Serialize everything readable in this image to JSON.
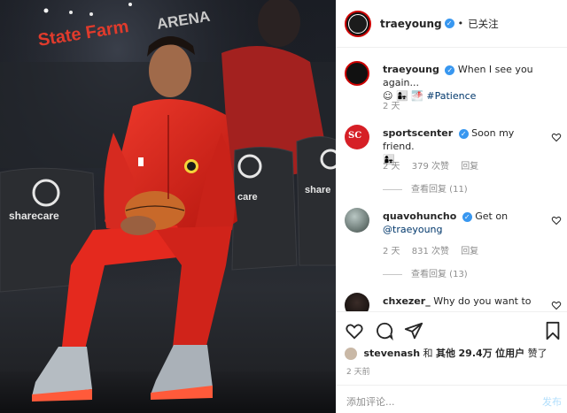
{
  "header": {
    "username": "traeyoung",
    "follow_status": "已关注"
  },
  "caption": {
    "username": "traeyoung",
    "text": "When I see you again...",
    "emojis": "☺ 👩‍👧 🌁",
    "hashtag": "#Patience",
    "age": "2 天"
  },
  "comments": [
    {
      "username": "sportscenter",
      "text": "Soon my friend.",
      "second_line": "👩‍👧",
      "age": "2 天",
      "likes": "379 次赞",
      "reply": "回复",
      "view_replies": "查看回复 (11)",
      "avatar_text": "SC"
    },
    {
      "username": "quavohuncho",
      "text": "Get on",
      "second_line": "@traeyoung",
      "age": "2 天",
      "likes": "831 次赞",
      "reply": "回复",
      "view_replies": "查看回复 (13)"
    },
    {
      "username": "chxezer_",
      "text": "Why do you want to"
    }
  ],
  "likes": {
    "liker": "stevenash",
    "connector": "和",
    "others": "其他",
    "count": "29.4万",
    "suffix": "位用户",
    "action": "赞了"
  },
  "post_time": "2 天前",
  "comment_box": {
    "placeholder": "添加评论...",
    "post_label": "发布"
  },
  "photo": {
    "arena_sign": "State Farm",
    "arena_sign_2": "ARENA",
    "seat_brand": "sharecare"
  },
  "colors": {
    "verified": "#3897f0",
    "link": "#00376b",
    "jersey_red": "#e0241f",
    "sportscenter_red": "#d61f26"
  }
}
